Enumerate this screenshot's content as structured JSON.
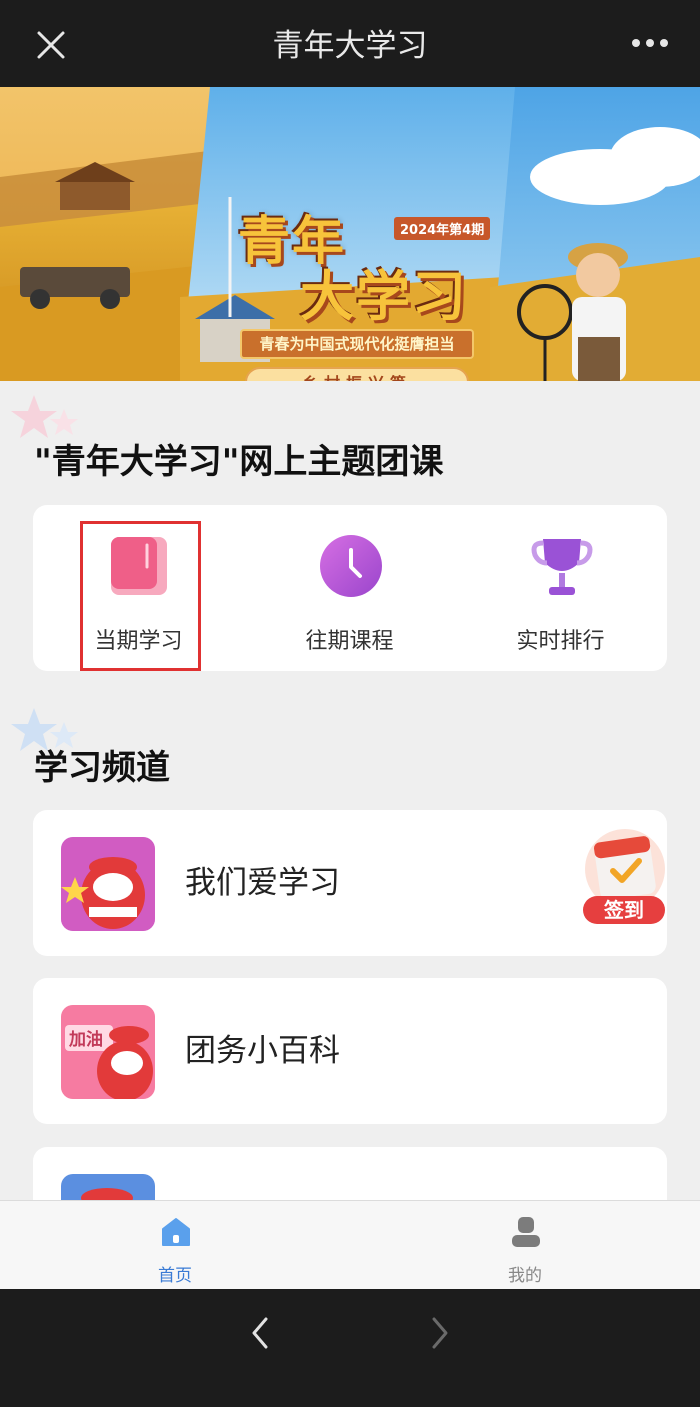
{
  "header": {
    "title": "青年大学习",
    "close_icon": "close-icon",
    "more_icon": "more-icon"
  },
  "banner": {
    "title_line1": "青年",
    "title_line2": "大学习",
    "issue": "2024年第4期",
    "slogan": "青春为中国式现代化挺膺担当",
    "part": "乡村振兴篇"
  },
  "section_course": {
    "title": "\"青年大学习\"网上主题团课"
  },
  "tabs": [
    {
      "label": "当期学习",
      "icon": "book-icon",
      "color": "#f0608a"
    },
    {
      "label": "往期课程",
      "icon": "clock-icon",
      "color": "#b14fd8"
    },
    {
      "label": "实时排行",
      "icon": "trophy-icon",
      "color": "#9b55d6"
    }
  ],
  "section_channel": {
    "title": "学习频道"
  },
  "channels": [
    {
      "label": "我们爱学习",
      "thumb_icon": "mascot-thumbsup-icon"
    },
    {
      "label": "团务小百科",
      "thumb_icon": "mascot-cheer-icon"
    },
    {
      "label": "",
      "thumb_icon": "mascot-icon"
    }
  ],
  "checkin": {
    "label": "签到",
    "icon": "calendar-check-icon"
  },
  "bottom_nav": [
    {
      "label": "首页",
      "icon": "home-icon",
      "active": true
    },
    {
      "label": "我的",
      "icon": "user-icon",
      "active": false
    }
  ],
  "browser_nav": {
    "back_icon": "back-arrow-icon",
    "forward_icon": "forward-arrow-icon"
  },
  "colors": {
    "active": "#3a7bd5",
    "inactive": "#888888",
    "highlight": "#e03131"
  }
}
